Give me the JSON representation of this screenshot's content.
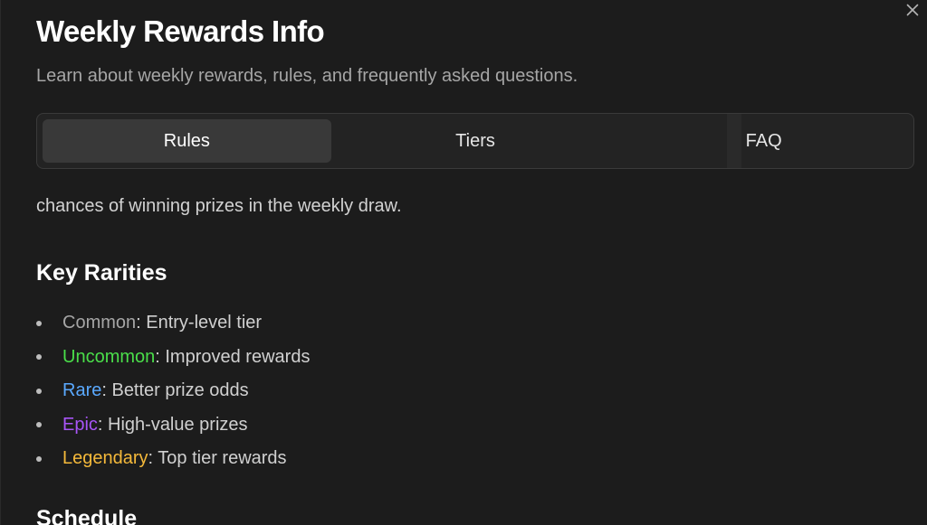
{
  "dialog": {
    "title": "Weekly Rewards Info",
    "subtitle": "Learn about weekly rewards, rules, and frequently asked questions.",
    "close_icon": "close-icon"
  },
  "tabs": [
    {
      "label": "Rules",
      "active": true
    },
    {
      "label": "Tiers",
      "active": false
    },
    {
      "label": "FAQ",
      "active": false
    }
  ],
  "content": {
    "intro_fragment": "chances of winning prizes in the weekly draw.",
    "key_rarities_heading": "Key Rarities",
    "rarities": [
      {
        "name": "Common",
        "description": ": Entry-level tier",
        "color": "#a6a6a6"
      },
      {
        "name": "Uncommon",
        "description": ": Improved rewards",
        "color": "#4ade4a"
      },
      {
        "name": "Rare",
        "description": ": Better prize odds",
        "color": "#5aa9ff"
      },
      {
        "name": "Epic",
        "description": ": High-value prizes",
        "color": "#a855f7"
      },
      {
        "name": "Legendary",
        "description": ": Top tier rewards",
        "color": "#f5b93a"
      }
    ],
    "schedule_heading": "Schedule"
  },
  "colors": {
    "background": "#1c1c1c",
    "tab_active": "#393939",
    "text_primary": "#ffffff",
    "text_secondary": "#a6a6a6"
  }
}
